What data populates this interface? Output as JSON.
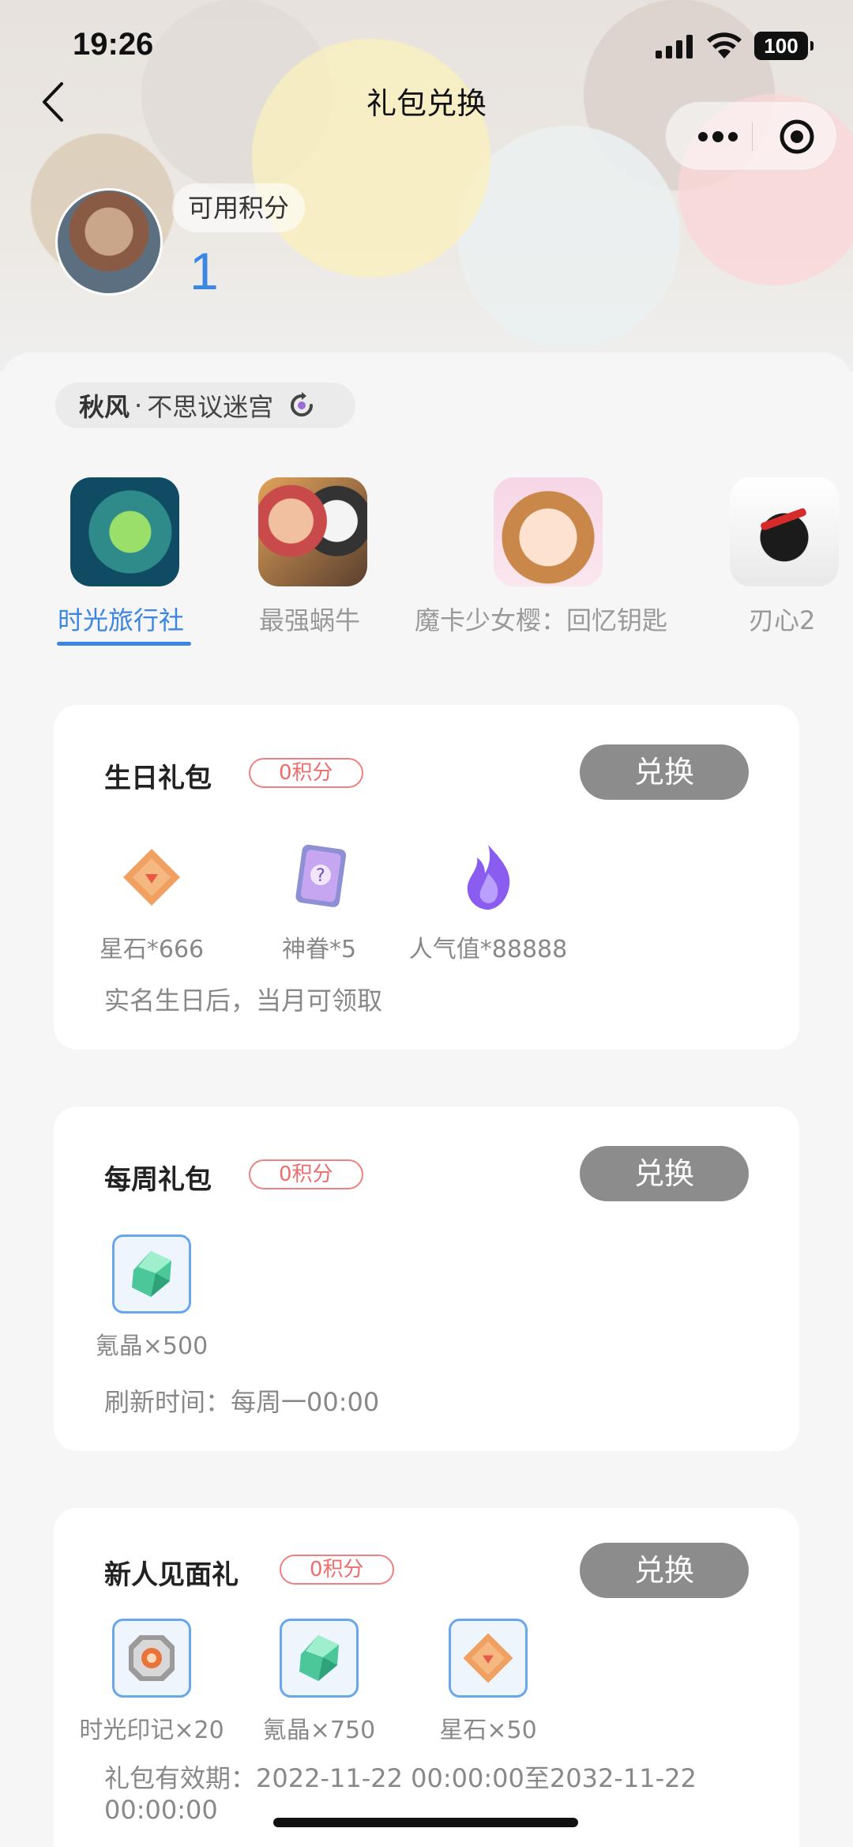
{
  "status_bar": {
    "time": "19:26",
    "battery": "100"
  },
  "nav": {
    "title": "礼包兑换"
  },
  "points": {
    "label": "可用积分",
    "value": "1"
  },
  "game_selector": {
    "server": "秋风",
    "separator": "·",
    "game": "不思议迷宫"
  },
  "tabs": [
    {
      "label": "时光旅行社",
      "active": true
    },
    {
      "label": "最强蜗牛",
      "active": false
    },
    {
      "label": "魔卡少女樱：回忆钥匙",
      "active": false
    },
    {
      "label": "刃心2",
      "active": false
    }
  ],
  "cards": [
    {
      "title": "生日礼包",
      "cost": "0积分",
      "button": "兑换",
      "items": [
        {
          "label": "星石*666",
          "icon": "star-stone-icon"
        },
        {
          "label": "神眷*5",
          "icon": "divine-card-icon"
        },
        {
          "label": "人气值*88888",
          "icon": "purple-flame-icon"
        }
      ],
      "note": "实名生日后，当月可领取"
    },
    {
      "title": "每周礼包",
      "cost": "0积分",
      "button": "兑换",
      "items": [
        {
          "label": "氪晶×500",
          "icon": "green-crystal-icon"
        }
      ],
      "note": "刷新时间：每周一00:00"
    },
    {
      "title": "新人见面礼",
      "cost": "0积分",
      "button": "兑换",
      "items": [
        {
          "label": "时光印记×20",
          "icon": "time-seal-icon"
        },
        {
          "label": "氪晶×750",
          "icon": "green-crystal-icon"
        },
        {
          "label": "星石×50",
          "icon": "star-stone-icon"
        }
      ],
      "note_line1": "礼包有效期：2022-11-22 00:00:00至2032-11-22",
      "note_line2": "00:00:00"
    }
  ],
  "colors": {
    "accent": "#3a86e0",
    "cost_red": "#ee6d6d",
    "button_gray": "#8c8c8c"
  }
}
